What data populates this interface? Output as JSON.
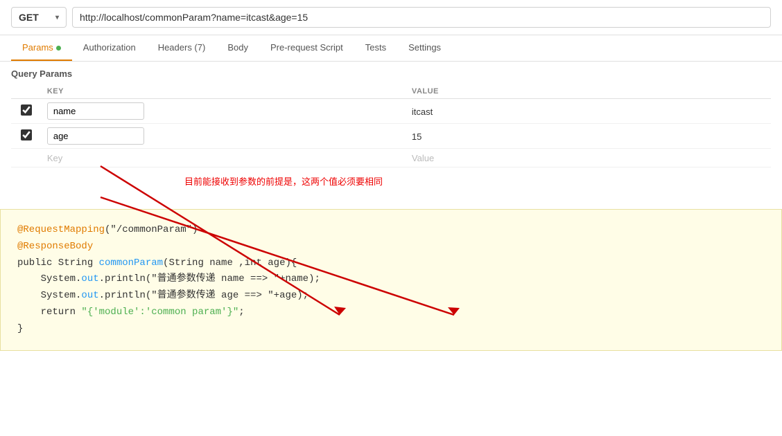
{
  "urlbar": {
    "method": "GET",
    "chevron": "▾",
    "url": "http://localhost/commonParam?name=itcast&age=15"
  },
  "tabs": [
    {
      "label": "Params",
      "active": true,
      "dot": true,
      "id": "params"
    },
    {
      "label": "Authorization",
      "active": false,
      "dot": false,
      "id": "authorization"
    },
    {
      "label": "Headers (7)",
      "active": false,
      "dot": false,
      "id": "headers"
    },
    {
      "label": "Body",
      "active": false,
      "dot": false,
      "id": "body"
    },
    {
      "label": "Pre-request Script",
      "active": false,
      "dot": false,
      "id": "pre-request"
    },
    {
      "label": "Tests",
      "active": false,
      "dot": false,
      "id": "tests"
    },
    {
      "label": "Settings",
      "active": false,
      "dot": false,
      "id": "settings"
    }
  ],
  "params": {
    "section_title": "Query Params",
    "columns": {
      "key": "KEY",
      "value": "VALUE"
    },
    "rows": [
      {
        "checked": true,
        "key": "name",
        "value": "itcast"
      },
      {
        "checked": true,
        "key": "age",
        "value": "15"
      }
    ],
    "placeholder_key": "Key",
    "placeholder_value": "Value"
  },
  "annotation": {
    "text": "目前能接收到参数的前提是，这两个值必须要相同"
  },
  "code": {
    "lines": [
      {
        "text": "@RequestMapping(\"/commonParam\")",
        "parts": [
          {
            "t": "@RequestMapping",
            "c": "orange"
          },
          {
            "t": "(\"/commonParam\")",
            "c": "dark"
          }
        ]
      },
      {
        "text": "@ResponseBody",
        "parts": [
          {
            "t": "@ResponseBody",
            "c": "orange"
          }
        ]
      },
      {
        "text": "public String commonParam(String name ,int age){",
        "parts": [
          {
            "t": "public ",
            "c": "dark"
          },
          {
            "t": "String ",
            "c": "dark"
          },
          {
            "t": "commonParam",
            "c": "blue"
          },
          {
            "t": "(String name ,int age){",
            "c": "dark"
          }
        ]
      },
      {
        "text": "    System.out.println(\"普通参数传递 name ==> \"+name);",
        "parts": [
          {
            "t": "    System.",
            "c": "dark"
          },
          {
            "t": "out",
            "c": "blue"
          },
          {
            "t": ".println(\"普通参数传递 name ==> \"+name);",
            "c": "dark"
          }
        ]
      },
      {
        "text": "    System.out.println(\"普通参数传递 age ==> \"+age);",
        "parts": [
          {
            "t": "    System.",
            "c": "dark"
          },
          {
            "t": "out",
            "c": "blue"
          },
          {
            "t": ".println(\"普通参数传递 age ==> \"+age);",
            "c": "dark"
          }
        ]
      },
      {
        "text": "    return \"{'module':'common param'}\";",
        "parts": [
          {
            "t": "    return ",
            "c": "dark"
          },
          {
            "t": "\"{'module':'common param'}\"",
            "c": "green"
          },
          {
            "t": ";",
            "c": "dark"
          }
        ]
      },
      {
        "text": "}",
        "parts": [
          {
            "t": "}",
            "c": "dark"
          }
        ]
      }
    ]
  }
}
